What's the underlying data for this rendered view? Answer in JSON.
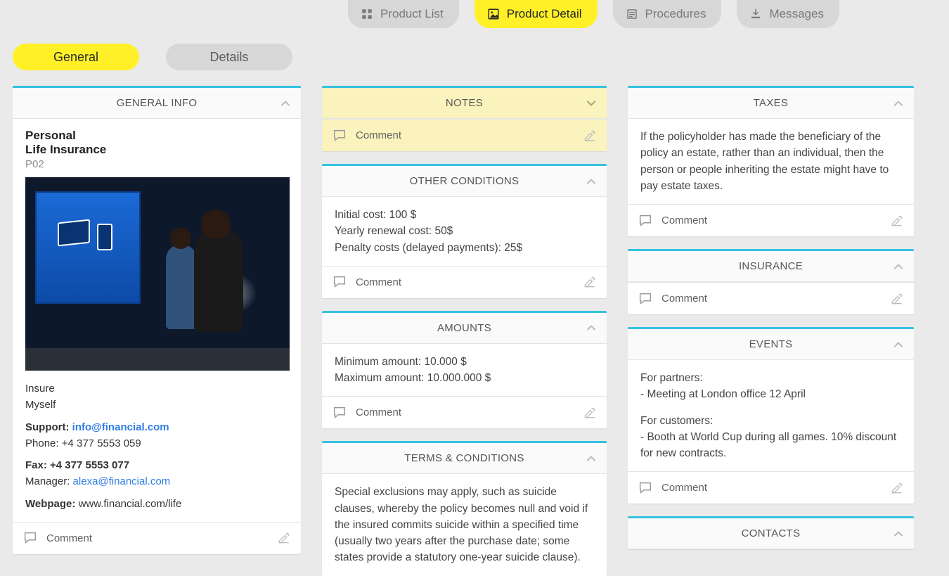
{
  "top_tabs": {
    "product_list": "Product List",
    "product_detail": "Product Detail",
    "procedures": "Procedures",
    "messages": "Messages"
  },
  "sub_tabs": {
    "general": "General",
    "details": "Details"
  },
  "comment_label": "Comment",
  "general_info": {
    "header": "GENERAL INFO",
    "title_line1": "Personal",
    "title_line2": "Life Insurance",
    "code": "P02",
    "whom_line1": "Insure",
    "whom_line2": "Myself",
    "support_label": "Support:",
    "support_email": "info@financial.com",
    "phone_label": "Phone:",
    "phone_value": "+4 377 5553 059",
    "fax_label": "Fax:",
    "fax_value": "+4 377 5553 077",
    "manager_label": "Manager:",
    "manager_email": "alexa@financial.com",
    "webpage_label": "Webpage:",
    "webpage_value": "www.financial.com/life"
  },
  "notes": {
    "header": "NOTES"
  },
  "other_conditions": {
    "header": "OTHER CONDITIONS",
    "lines": [
      "Initial cost: 100 $",
      "Yearly renewal cost: 50$",
      "Penalty costs (delayed payments): 25$"
    ]
  },
  "amounts": {
    "header": "AMOUNTS",
    "lines": [
      "Minimum amount: 10.000 $",
      "Maximum amount: 10.000.000 $"
    ]
  },
  "terms": {
    "header": "TERMS & CONDITIONS",
    "text": "Special exclusions may apply, such as suicide clauses, whereby the policy becomes null and void if the insured commits suicide within a specified time (usually two years after the purchase date; some states provide a statutory one-year suicide clause)."
  },
  "taxes": {
    "header": "TAXES",
    "text": "If the policyholder has made the beneficiary of the policy an estate, rather than an individual, then the person or people inheriting the estate might have to pay estate taxes."
  },
  "insurance": {
    "header": "INSURANCE"
  },
  "events": {
    "header": "EVENTS",
    "lines": [
      "For partners:",
      "- Meeting at London office 12 April",
      "",
      "For customers:",
      "- Booth at World Cup during all games. 10% discount for new contracts."
    ]
  },
  "contacts": {
    "header": "CONTACTS"
  }
}
